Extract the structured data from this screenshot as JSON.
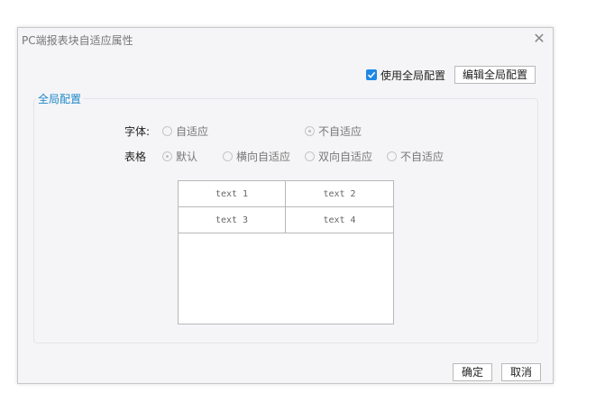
{
  "dialog": {
    "title": "PC端报表块自适应属性",
    "close_icon": "close-icon"
  },
  "toolbar": {
    "use_global_label": "使用全局配置",
    "use_global_checked": true,
    "edit_global_label": "编辑全局配置"
  },
  "group": {
    "legend": "全局配置",
    "font_row": {
      "label": "字体:",
      "options": [
        {
          "label": "自适应",
          "checked": false
        },
        {
          "label": "不自适应",
          "checked": true
        }
      ]
    },
    "table_row": {
      "label": "表格",
      "options": [
        {
          "label": "默认",
          "checked": true
        },
        {
          "label": "横向自适应",
          "checked": false
        },
        {
          "label": "双向自适应",
          "checked": false
        },
        {
          "label": "不自适应",
          "checked": false
        }
      ]
    },
    "preview": {
      "cells": [
        "text 1",
        "text 2",
        "text 3",
        "text 4"
      ]
    }
  },
  "footer": {
    "ok_label": "确定",
    "cancel_label": "取消"
  },
  "colors": {
    "accent": "#1e88e5",
    "legend": "#1e88c8"
  }
}
